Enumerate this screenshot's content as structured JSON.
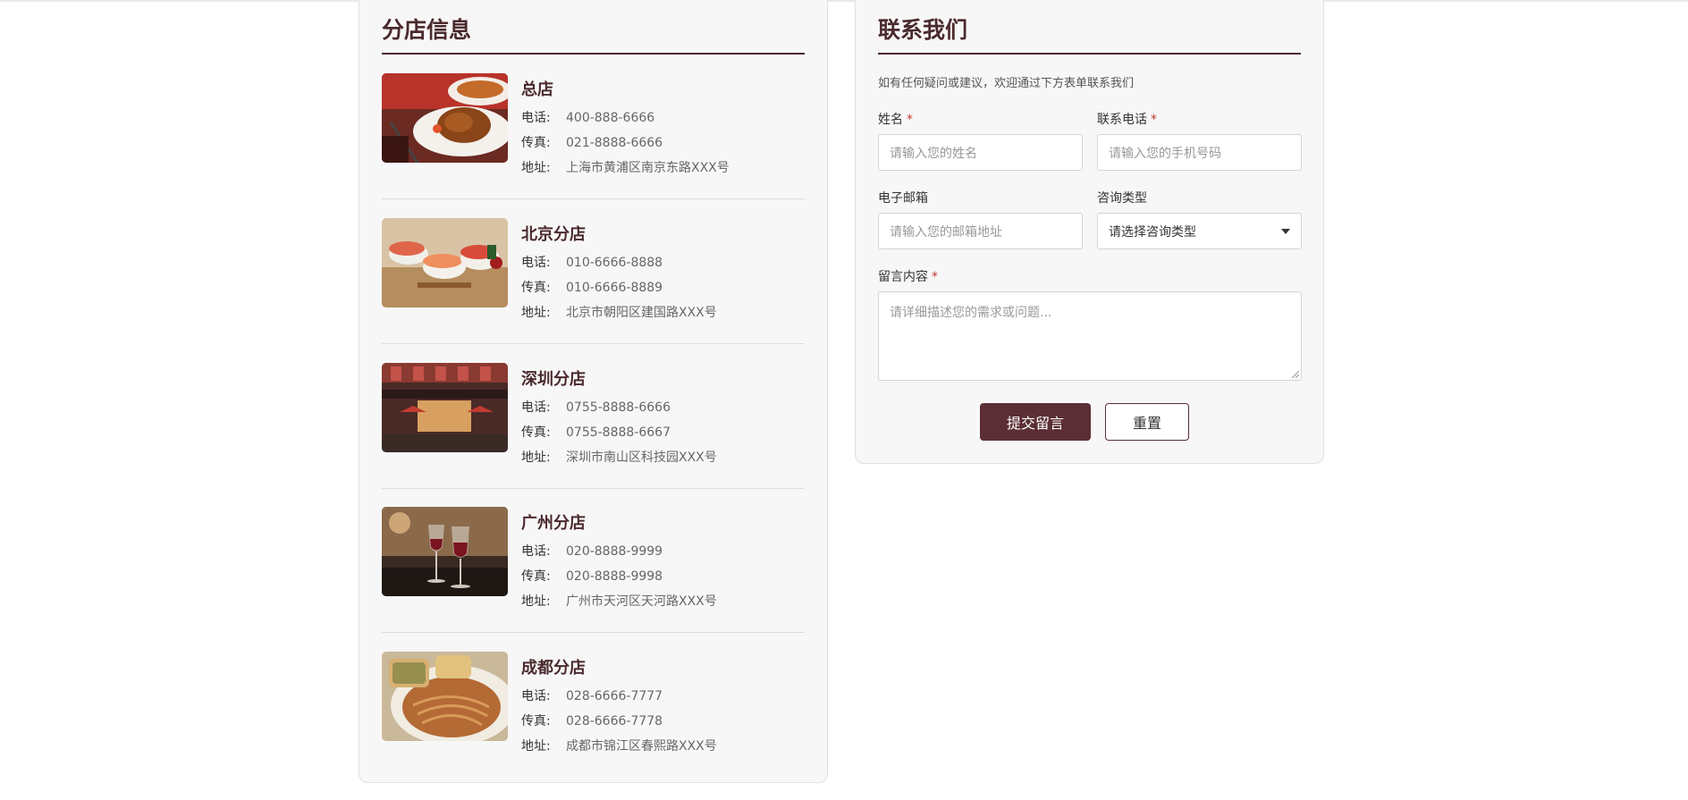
{
  "branches_section": {
    "title": "分店信息",
    "branches": [
      {
        "name": "总店",
        "phone_label": "电话:",
        "phone": "400-888-6666",
        "fax_label": "传真:",
        "fax": "021-8888-6666",
        "address_label": "地址:",
        "address": "上海市黄浦区南京东路XXX号"
      },
      {
        "name": "北京分店",
        "phone_label": "电话:",
        "phone": "010-6666-8888",
        "fax_label": "传真:",
        "fax": "010-6666-8889",
        "address_label": "地址:",
        "address": "北京市朝阳区建国路XXX号"
      },
      {
        "name": "深圳分店",
        "phone_label": "电话:",
        "phone": "0755-8888-6666",
        "fax_label": "传真:",
        "fax": "0755-8888-6667",
        "address_label": "地址:",
        "address": "深圳市南山区科技园XXX号"
      },
      {
        "name": "广州分店",
        "phone_label": "电话:",
        "phone": "020-8888-9999",
        "fax_label": "传真:",
        "fax": "020-8888-9998",
        "address_label": "地址:",
        "address": "广州市天河区天河路XXX号"
      },
      {
        "name": "成都分店",
        "phone_label": "电话:",
        "phone": "028-6666-7777",
        "fax_label": "传真:",
        "fax": "028-6666-7778",
        "address_label": "地址:",
        "address": "成都市锦江区春熙路XXX号"
      }
    ]
  },
  "contact_section": {
    "title": "联系我们",
    "intro": "如有任何疑问或建议，欢迎通过下方表单联系我们",
    "required_mark": "*",
    "name": {
      "label": "姓名",
      "placeholder": "请输入您的姓名"
    },
    "phone": {
      "label": "联系电话",
      "placeholder": "请输入您的手机号码"
    },
    "email": {
      "label": "电子邮箱",
      "placeholder": "请输入您的邮箱地址"
    },
    "type": {
      "label": "咨询类型",
      "selected": "请选择咨询类型"
    },
    "message": {
      "label": "留言内容",
      "placeholder": "请详细描述您的需求或问题..."
    },
    "submit_label": "提交留言",
    "reset_label": "重置"
  },
  "colors": {
    "brand": "#5a2e34",
    "heading": "#4a2a2e",
    "panel_bg": "#f8f7f7",
    "required": "#c0392b"
  }
}
